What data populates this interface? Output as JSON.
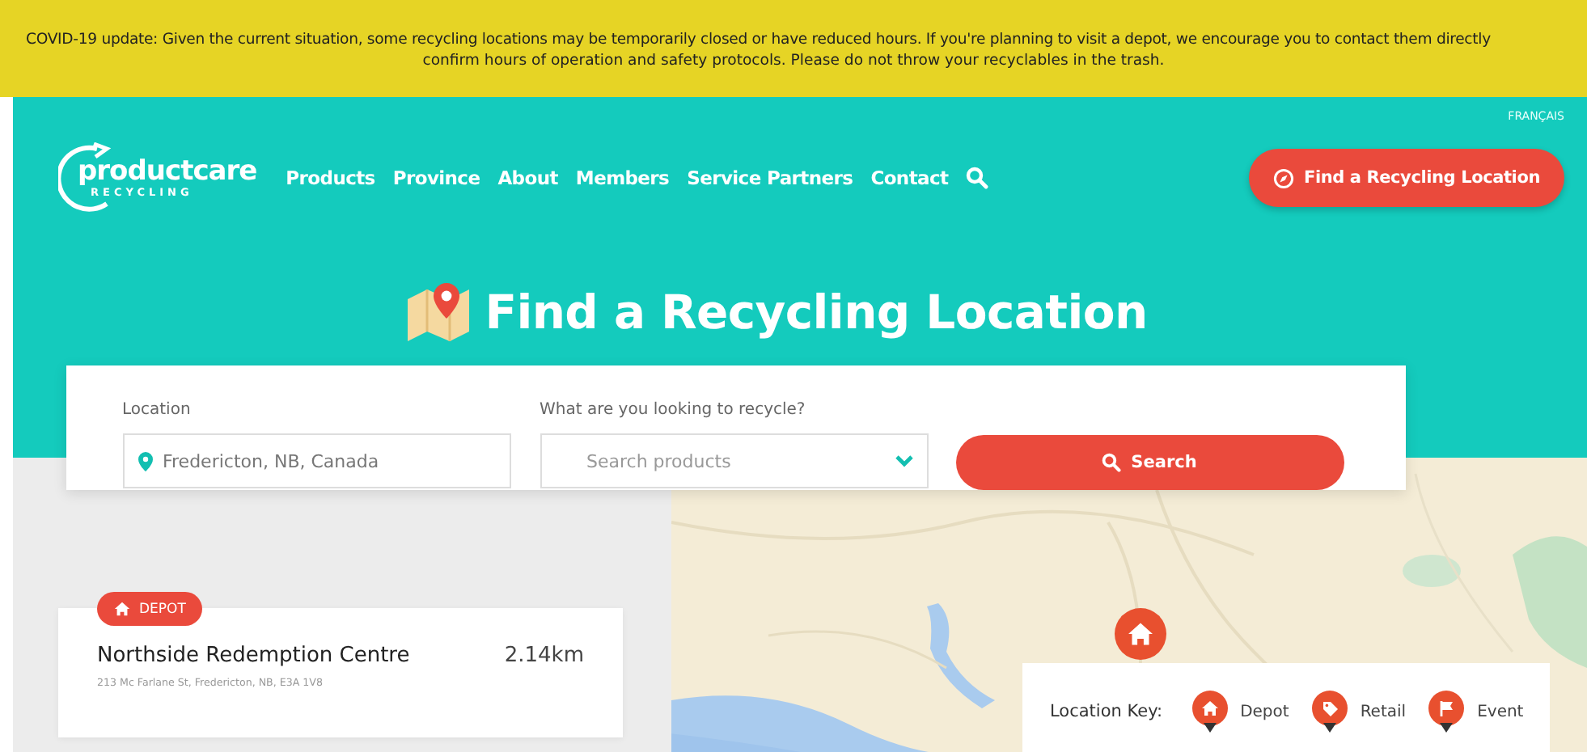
{
  "banner": {
    "lines": [
      "COVID-19 update: Given the current situation, some recycling locations may be temporarily closed or have reduced hours. If you're planning to visit a depot, we encourage you to contact them directly",
      "confirm hours of operation and safety protocols. Please do not throw your recyclables in the trash."
    ]
  },
  "header": {
    "language": "FRANÇAIS",
    "logo": {
      "name": "productcare",
      "tagline": "RECYCLING"
    },
    "nav": [
      "Products",
      "Province",
      "About",
      "Members",
      "Service Partners",
      "Contact"
    ],
    "cta": "Find a Recycling Location"
  },
  "hero": {
    "title": "Find a Recycling Location"
  },
  "search": {
    "location_label": "Location",
    "location_value": "Fredericton, NB, Canada",
    "product_label": "What are you looking to recycle?",
    "product_placeholder": "Search products",
    "button": "Search"
  },
  "results": [
    {
      "kind": "depot",
      "badge": "DEPOT",
      "name": "Northside Redemption Centre",
      "distance": "2.14km",
      "address": "213 Mc Farlane St, Fredericton, NB, E3A 1V8"
    }
  ],
  "map": {
    "legend": {
      "title": "Location Key:",
      "items": [
        {
          "kind": "depot",
          "label": "Depot"
        },
        {
          "kind": "retail",
          "label": "Retail"
        },
        {
          "kind": "event",
          "label": "Event"
        }
      ]
    }
  }
}
